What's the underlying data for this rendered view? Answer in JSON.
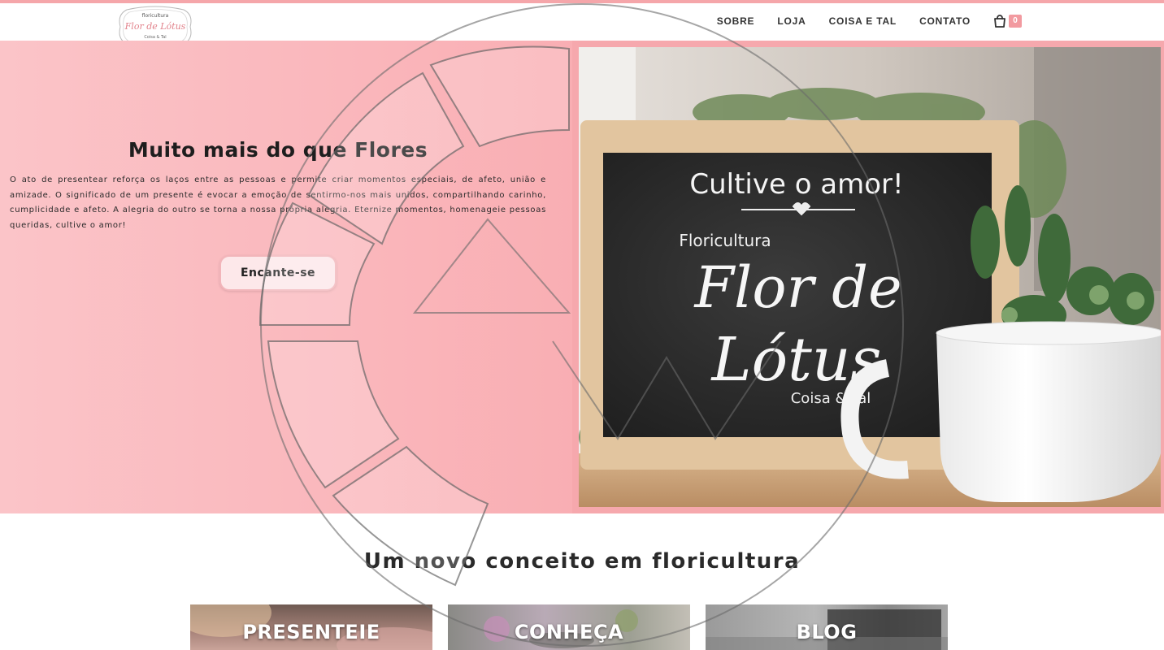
{
  "header": {
    "logo": {
      "line1": "floricultura",
      "line2": "Flor de Lótus",
      "line3": "Coisa & Tal"
    },
    "nav": [
      {
        "label": "SOBRE"
      },
      {
        "label": "LOJA"
      },
      {
        "label": "COISA E TAL"
      },
      {
        "label": "CONTATO"
      }
    ],
    "cart": {
      "icon": "shopping-bag-icon",
      "count": "0"
    }
  },
  "hero": {
    "title": "Muito mais do que Flores",
    "text": "O ato de presentear reforça os laços entre as pessoas e permite criar momentos especiais, de afeto, união e amizade.  O significado de um presente é evocar a emoção de sentirmo-nos mais unidos, compartilhando carinho, cumplicidade e afeto. A alegria do outro se torna a nossa própria alegria. Eternize momentos, homenageie pessoas queridas, cultive o amor!",
    "button_label": "Encante-se",
    "photo": {
      "board_line1": "Cultive o amor!",
      "board_line2": "Floricultura",
      "board_line3": "Flor de",
      "board_line4": "Lótus",
      "board_line5": "Coisa & Tal"
    }
  },
  "section": {
    "title": "Um novo conceito em floricultura",
    "cards": [
      {
        "label": "PRESENTEIE"
      },
      {
        "label": "CONHEÇA"
      },
      {
        "label": "BLOG"
      }
    ]
  },
  "colors": {
    "accent_pink": "#f5a6aa",
    "hero_pink": "#fab8bd",
    "badge_pink": "#f29aa0"
  }
}
